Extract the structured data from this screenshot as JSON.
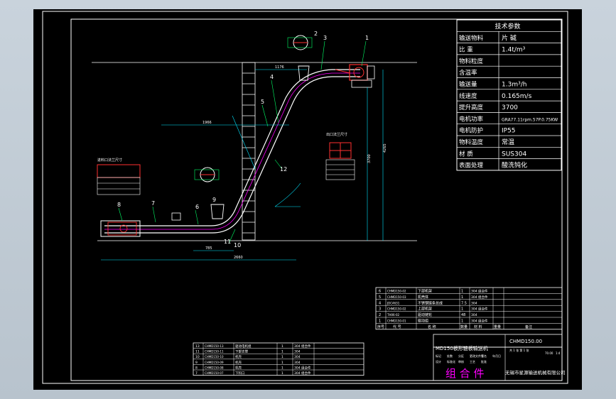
{
  "drawing": {
    "title_rows": [
      {
        "label": "技术参数",
        "value": ""
      },
      {
        "label": "输送物料",
        "value": "片 碱"
      },
      {
        "label": "比 重",
        "value": "1.4t/m³"
      },
      {
        "label": "物料粒度",
        "value": ""
      },
      {
        "label": "含温率",
        "value": ""
      },
      {
        "label": "输送量",
        "value": "1.3m³/h"
      },
      {
        "label": "线速度",
        "value": "0.165m/s"
      },
      {
        "label": "提升高度",
        "value": "3700"
      },
      {
        "label": "电机功率",
        "value": "GRA77.11rpm.57P.0.75KW"
      },
      {
        "label": "电机防护",
        "value": "IP55"
      },
      {
        "label": "物料温度",
        "value": "常温"
      },
      {
        "label": "材 质",
        "value": "SUS304"
      },
      {
        "label": "表面处理",
        "value": "酸洗钝化"
      }
    ],
    "callouts": [
      "1",
      "2",
      "3",
      "4",
      "5",
      "6",
      "7",
      "8",
      "9",
      "10",
      "11",
      "12"
    ],
    "dims": {
      "top": "1176",
      "mid": "1966",
      "base_left": "785",
      "base_total": "2660",
      "right_h1": "3700",
      "right_h2": "4265"
    },
    "inlet_note": "进料口法兰尺寸",
    "outlet_note": "出口法兰尺寸",
    "parts_lower": [
      {
        "no": "6",
        "code": "CHMD150-02",
        "name": "下部机架",
        "qty": "1",
        "mat": "304 组合件"
      },
      {
        "no": "5",
        "code": "CHMD150-03",
        "name": "机壳体",
        "qty": "1",
        "mat": "304 组合件"
      },
      {
        "no": "4",
        "code": "JDC4631",
        "name": "不锈钢链条总成",
        "qty": "7.5",
        "mat": "304"
      },
      {
        "no": "3",
        "code": "CHMD150-02",
        "name": "上部机架",
        "qty": "1",
        "mat": "304 组合件"
      },
      {
        "no": "2",
        "code": "TH06-02",
        "name": "驱动链轮",
        "qty": "48",
        "mat": "304"
      },
      {
        "no": "1",
        "code": "CHMD150-01",
        "name": "驱动组",
        "qty": "1",
        "mat": "304 组合件"
      }
    ],
    "parts_lower_header": {
      "no": "序号",
      "code": "代 号",
      "name": "名 称",
      "qty": "数量",
      "mat": "材 料",
      "wt": "重量",
      "note": "备注"
    },
    "parts_upper": [
      {
        "no": "13",
        "code": "CHMD150-13",
        "name": "驱动电机组",
        "qty": "1",
        "mat": "304 组合件"
      },
      {
        "no": "11",
        "code": "CHMD150-11",
        "name": "下部支撑",
        "qty": "1",
        "mat": "304"
      },
      {
        "no": "10",
        "code": "CHMD150-10",
        "name": "机壳",
        "qty": "1",
        "mat": "304"
      },
      {
        "no": "9",
        "code": "CHMD150-09",
        "name": "机壳",
        "qty": "1",
        "mat": "304"
      },
      {
        "no": "8",
        "code": "CHMD150-08",
        "name": "机壳",
        "qty": "1",
        "mat": "304 组合件"
      },
      {
        "no": "7",
        "code": "CHMD150-07",
        "name": "下料口",
        "qty": "1",
        "mat": "304 组合件"
      }
    ],
    "drawing_name": "MD150板形链板输送机",
    "drawing_code": "CHMD150.00",
    "assembly": "组 合 件",
    "company": "无锡市星源输送机械有限公司",
    "scale": "1:4",
    "sheets": "共 1 张 第 1 张",
    "weight": "70.00",
    "sig_cells": [
      "标记",
      "处数",
      "分区",
      "更改文件号",
      "签名",
      "年月日",
      "设计",
      "标准化",
      "审核",
      "工艺",
      "批准"
    ]
  }
}
